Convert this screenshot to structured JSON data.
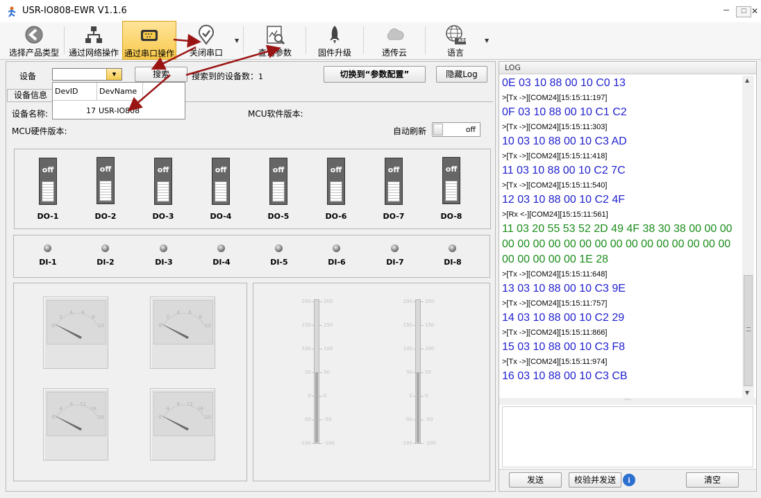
{
  "window": {
    "title": "USR-IO808-EWR V1.1.6",
    "min": "─",
    "max": "☐",
    "close": "✕"
  },
  "toolbar": {
    "select_product": "选择产品类型",
    "via_network": "通过网络操作",
    "via_serial": "通过串口操作",
    "close_serial": "关闭串口",
    "query_params": "查询参数",
    "firmware": "固件升级",
    "cloud": "透传云",
    "language": "语言",
    "icon_text_abc": "ABC"
  },
  "device_row": {
    "device_label": "设备",
    "search_btn": "搜索",
    "found_label": "搜索到的设备数：",
    "found_count": "1",
    "switch_btn": "切换到“参数配置”",
    "hide_log_btn": "隐藏Log"
  },
  "popup": {
    "col_id": "DevID",
    "col_name": "DevName",
    "rows": [
      {
        "id": "17",
        "name": "USR-IO808"
      }
    ]
  },
  "info": {
    "tab": "设备信息",
    "device_name_label": "设备名称:",
    "mcu_sw_label": "MCU软件版本:",
    "mcu_hw_label": "MCU硬件版本:",
    "auto_refresh_label": "自动刷新",
    "auto_refresh_state": "off"
  },
  "do_switches": [
    {
      "label": "DO-1",
      "state": "off"
    },
    {
      "label": "DO-2",
      "state": "off"
    },
    {
      "label": "DO-3",
      "state": "off"
    },
    {
      "label": "DO-4",
      "state": "off"
    },
    {
      "label": "DO-5",
      "state": "off"
    },
    {
      "label": "DO-6",
      "state": "off"
    },
    {
      "label": "DO-7",
      "state": "off"
    },
    {
      "label": "DO-8",
      "state": "off"
    }
  ],
  "di_inputs": [
    "DI-1",
    "DI-2",
    "DI-3",
    "DI-4",
    "DI-5",
    "DI-6",
    "DI-7",
    "DI-8"
  ],
  "gauges": [
    {
      "ticks": [
        "0",
        "2",
        "4",
        "6",
        "8",
        "10"
      ]
    },
    {
      "ticks": [
        "0",
        "2",
        "4",
        "6",
        "8",
        "10"
      ]
    },
    {
      "ticks": [
        "0",
        "4",
        "8",
        "12",
        "16",
        "20"
      ]
    },
    {
      "ticks": [
        "0",
        "4",
        "8",
        "12",
        "16",
        "20"
      ]
    }
  ],
  "sliders": {
    "ticks": [
      "200",
      "150",
      "100",
      "50",
      "0",
      "-50",
      "-100"
    ]
  },
  "log": {
    "header": "LOG",
    "lines": [
      {
        "t": "0E 03 10 88 00 10 C0 13",
        "k": "tx"
      },
      {
        "t": ">[Tx ->][COM24][15:15:11:197]",
        "k": "meta"
      },
      {
        "t": "0F 03 10 88 00 10 C1 C2",
        "k": "tx"
      },
      {
        "t": ">[Tx ->][COM24][15:15:11:303]",
        "k": "meta"
      },
      {
        "t": "10 03 10 88 00 10 C3 AD",
        "k": "tx"
      },
      {
        "t": ">[Tx ->][COM24][15:15:11:418]",
        "k": "meta"
      },
      {
        "t": "11 03 10 88 00 10 C2 7C",
        "k": "tx"
      },
      {
        "t": ">[Tx ->][COM24][15:15:11:540]",
        "k": "meta"
      },
      {
        "t": "12 03 10 88 00 10 C2 4F",
        "k": "tx"
      },
      {
        "t": ">[Rx <-][COM24][15:15:11:561]",
        "k": "meta"
      },
      {
        "t": "11 03 20 55 53 52 2D 49 4F 38 30 38 00 00 00",
        "k": "rx"
      },
      {
        "t": "00 00 00 00 00 00 00 00 00 00 00 00 00 00 00",
        "k": "rx"
      },
      {
        "t": "00 00 00 00 00 1E 28",
        "k": "rx"
      },
      {
        "t": ">[Tx ->][COM24][15:15:11:648]",
        "k": "meta"
      },
      {
        "t": "13 03 10 88 00 10 C3 9E",
        "k": "tx"
      },
      {
        "t": ">[Tx ->][COM24][15:15:11:757]",
        "k": "meta"
      },
      {
        "t": "14 03 10 88 00 10 C2 29",
        "k": "tx"
      },
      {
        "t": ">[Tx ->][COM24][15:15:11:866]",
        "k": "meta"
      },
      {
        "t": "15 03 10 88 00 10 C3 F8",
        "k": "tx"
      },
      {
        "t": ">[Tx ->][COM24][15:15:11:974]",
        "k": "meta"
      },
      {
        "t": "16 03 10 88 00 10 C3 CB",
        "k": "tx"
      }
    ],
    "send_btn": "发送",
    "check_send_btn": "校验并发送",
    "clear_btn": "清空",
    "info_icon": "i"
  },
  "colors": {
    "tx": "#1f1fd0",
    "rx": "#1a8c1a",
    "meta": "#000000",
    "annot_arrow": "#9b1414"
  }
}
